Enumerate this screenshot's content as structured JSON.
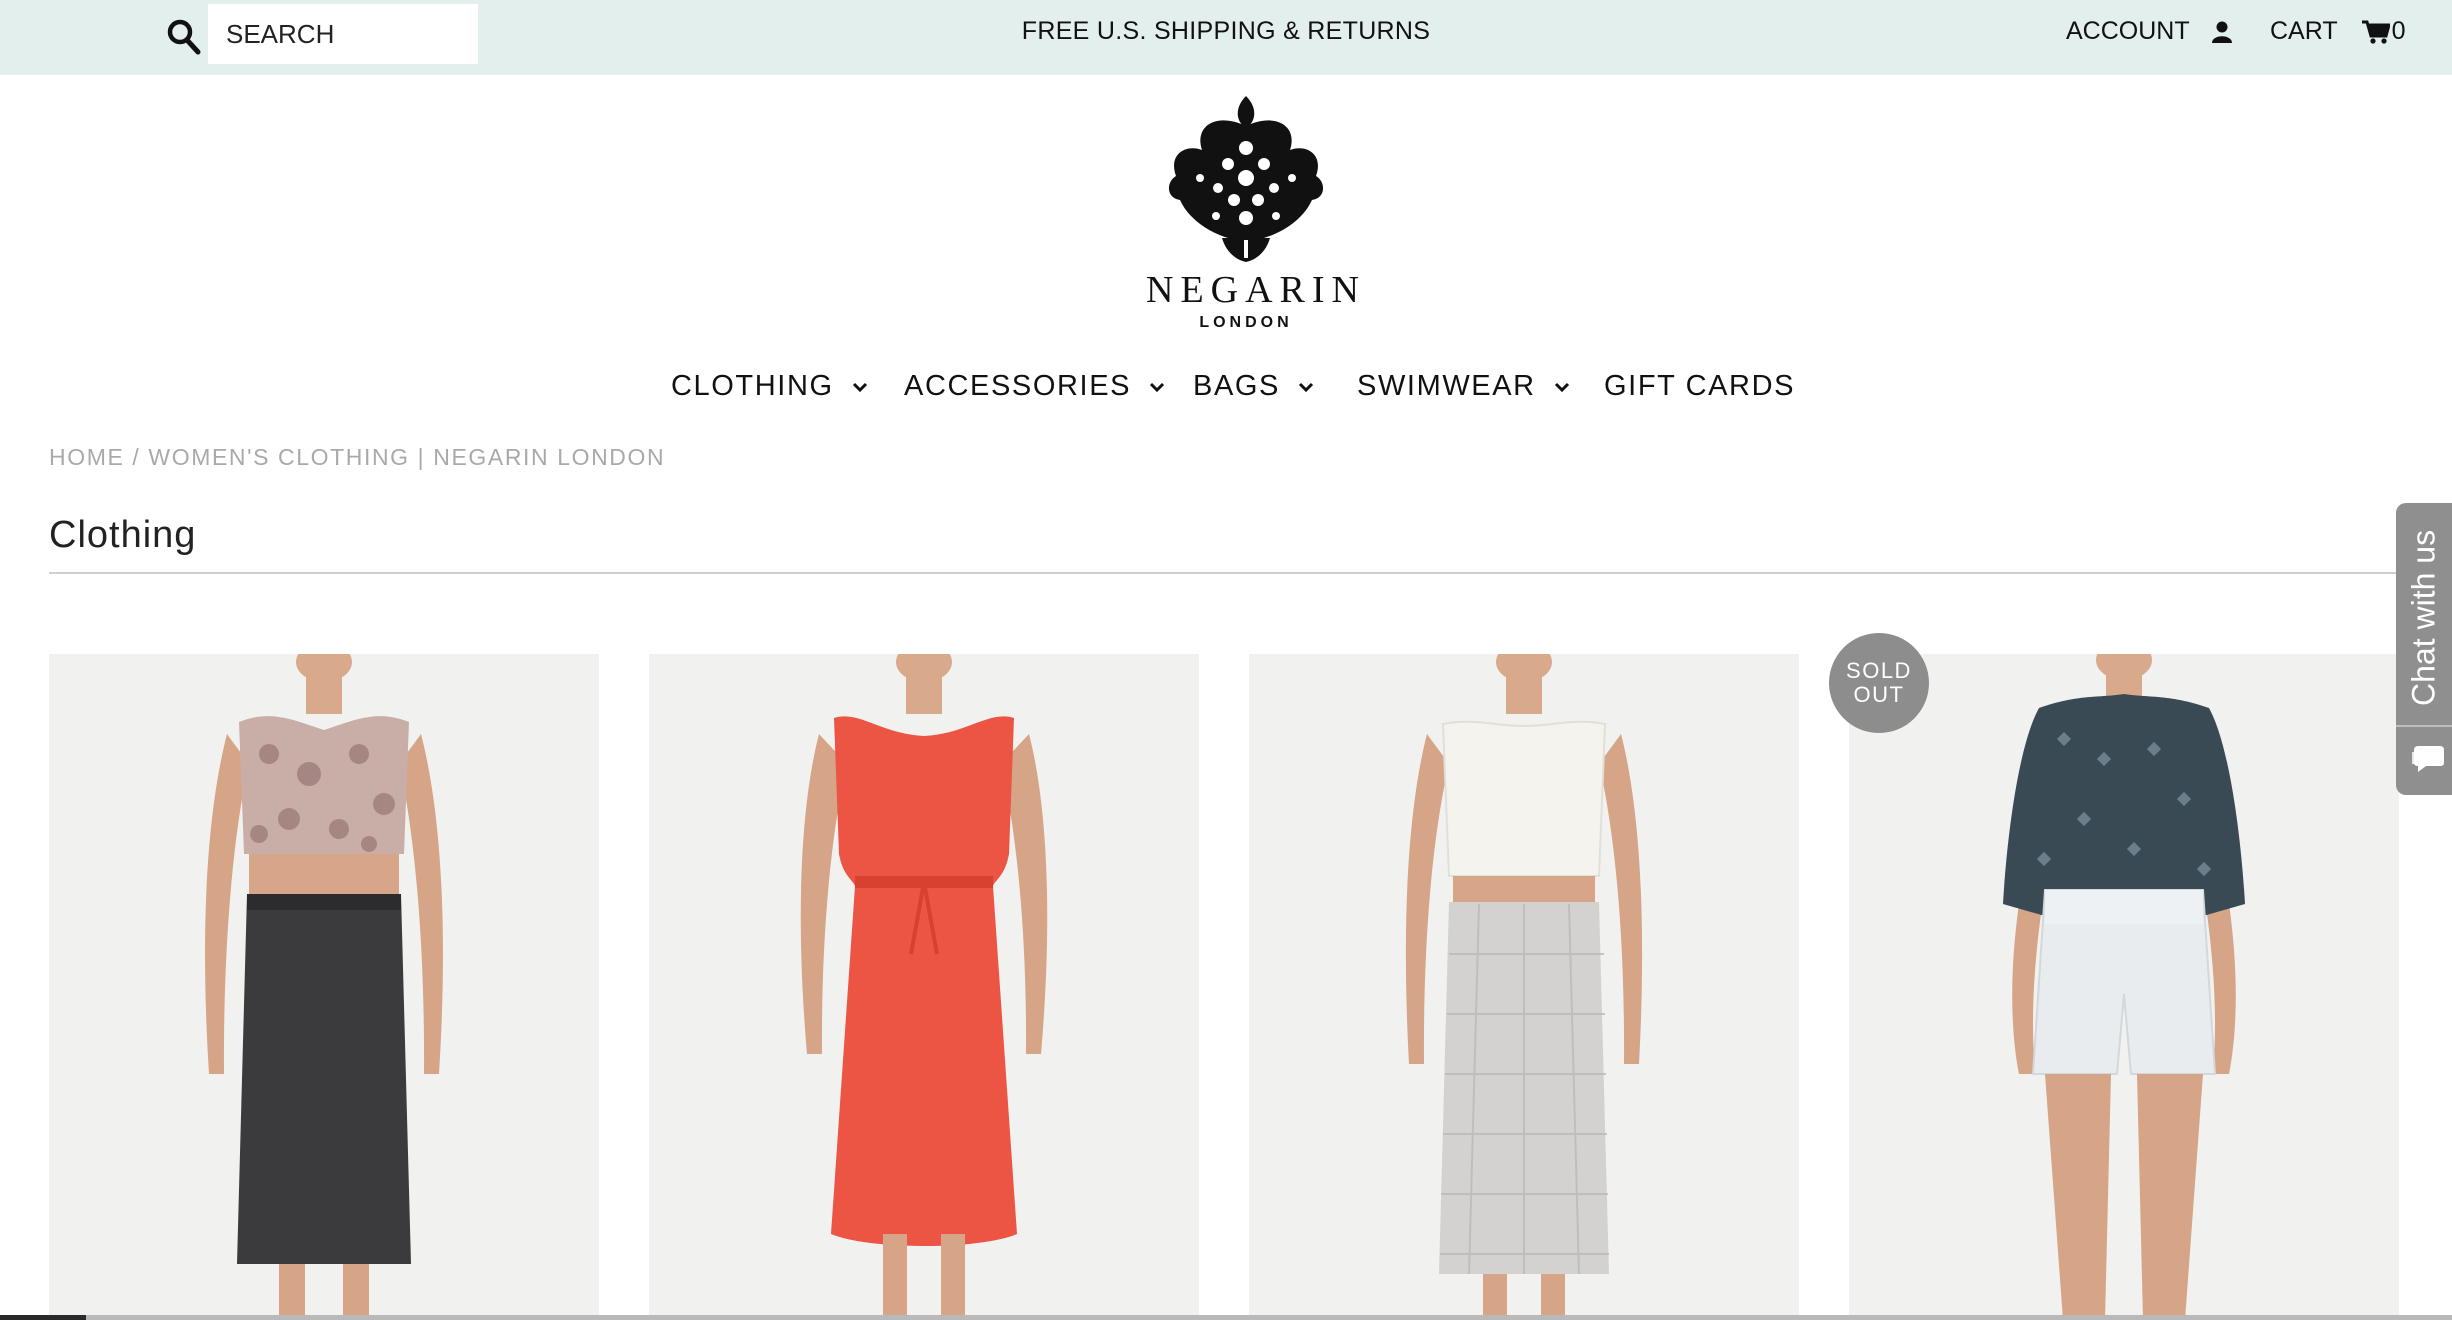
{
  "topbar": {
    "search_placeholder": "SEARCH",
    "promo": "FREE U.S. SHIPPING & RETURNS",
    "account_label": "ACCOUNT",
    "cart_label": "CART",
    "cart_count": "0"
  },
  "brand": {
    "name": "NEGARIN",
    "sub": "LONDON"
  },
  "nav": [
    {
      "label": "CLOTHING",
      "has_dropdown": true
    },
    {
      "label": "ACCESSORIES",
      "has_dropdown": true
    },
    {
      "label": "BAGS",
      "has_dropdown": true
    },
    {
      "label": "SWIMWEAR",
      "has_dropdown": true
    },
    {
      "label": "GIFT CARDS",
      "has_dropdown": false
    }
  ],
  "breadcrumb": {
    "home": "HOME",
    "separator": "/",
    "current": "WOMEN'S CLOTHING | NEGARIN LONDON"
  },
  "page_title": "Clothing",
  "products": [
    {
      "icon": "patterned-crop-top-and-black-skirt"
    },
    {
      "icon": "red-sleeveless-dress"
    },
    {
      "icon": "white-crop-top-and-grey-skirt"
    },
    {
      "icon": "printed-blouse-and-white-shorts",
      "badge": "SOLD OUT"
    }
  ],
  "badge": {
    "line1": "SOLD",
    "line2": "OUT"
  },
  "chat": {
    "label": "Chat with us"
  },
  "colors": {
    "topbar_bg": "#e3efec",
    "badge_bg": "#8d8d8d",
    "chat_bg": "#8f8f8f",
    "breadcrumb_text": "#a9a9a9",
    "red_dress": "#ec5444"
  }
}
